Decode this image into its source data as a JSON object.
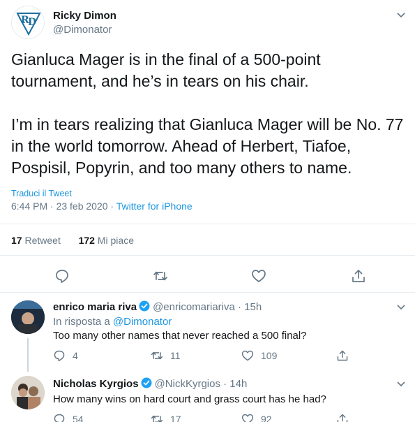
{
  "tweet": {
    "author_name": "Ricky Dimon",
    "author_handle": "@Dimonator",
    "text": "Gianluca Mager is in the final of a 500-point tournament, and he’s in tears on his chair.\n\nI’m in tears realizing that Gianluca Mager will be No. 77 in the world tomorrow. Ahead of Herbert, Tiafoe, Pospisil, Popyrin, and too many others to name.",
    "translate_label": "Traduci il Tweet",
    "timestamp": "6:44 PM · 23 feb 2020 · ",
    "source": "Twitter for iPhone",
    "retweets_count": "17",
    "retweets_label": "Retweet",
    "likes_count": "172",
    "likes_label": "Mi piace"
  },
  "icons": {
    "reply": "reply-icon",
    "retweet": "retweet-icon",
    "like": "like-icon",
    "share": "share-icon",
    "caret": "chevron-down-icon",
    "verified": "verified-badge-icon"
  },
  "colors": {
    "accent": "#1b95e0",
    "verified": "#1da1f2",
    "secondary_text": "#657786",
    "divider": "#e6ecf0"
  },
  "replies": [
    {
      "author_name": "enrico maria riva",
      "author_handle": "@enricomariariva · 15h",
      "in_reply_prefix": "In risposta a ",
      "in_reply_handle": "@Dimonator",
      "text": "Too many other names that never reached a 500 final?",
      "reply_count": "4",
      "retweet_count": "11",
      "like_count": "109"
    },
    {
      "author_name": "Nicholas Kyrgios",
      "author_handle": "@NickKyrgios · 14h",
      "text": "How many wins on hard court and grass court has he had?",
      "reply_count": "54",
      "retweet_count": "17",
      "like_count": "92"
    }
  ]
}
